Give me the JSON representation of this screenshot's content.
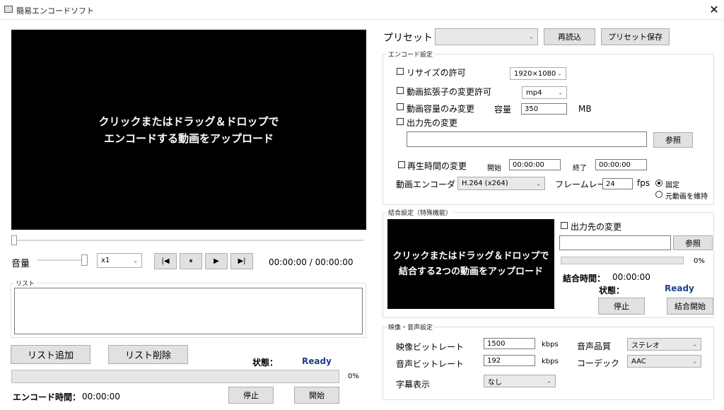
{
  "window": {
    "title": "簡易エンコードソフト",
    "close_glyph": "✕",
    "app_icon": "app-window-icon"
  },
  "preview": {
    "line1": "クリックまたはドラッグ＆ドロップで",
    "line2": "エンコードする動画をアップロード"
  },
  "volume": {
    "label": "音量",
    "level": 1.0
  },
  "seek": {
    "position": 0.0
  },
  "speed": {
    "value": "x1"
  },
  "player": {
    "prev_icon": "skip-previous-icon",
    "prev_glyph": "|◀",
    "pause_icon": "pause-icon",
    "pause_glyph": "⏸",
    "play_icon": "play-icon",
    "play_glyph": "▶",
    "next_icon": "skip-next-icon",
    "next_glyph": "▶|",
    "time": "00:00:00 / 00:00:00"
  },
  "list": {
    "legend": "リスト",
    "add_label": "リスト追加",
    "remove_label": "リスト削除",
    "status_label": "状態：",
    "status_value": "Ready",
    "progress_percent": "0%",
    "progress": 0,
    "encode_time_label": "エンコード時間：",
    "encode_time_value": "00:00:00",
    "stop_label": "停止",
    "start_label": "開始"
  },
  "preset": {
    "label": "プリセット",
    "value": "",
    "reload_label": "再読込",
    "save_label": "プリセット保存"
  },
  "encode": {
    "legend": "エンコード設定",
    "resize_label": "リサイズの許可",
    "resize_value": "1920×1080",
    "ext_label": "動画拡張子の変更許可",
    "ext_value": "mp4",
    "size_only_label": "動画容量のみ変更",
    "capacity_label": "容量",
    "capacity_value": "350",
    "capacity_unit": "MB",
    "output_label": "出力先の変更",
    "output_value": "",
    "browse_label": "参照",
    "playtime_label": "再生時間の変更",
    "start_label": "開始",
    "start_value": "00:00:00",
    "end_label": "終了",
    "end_value": "00:00:00",
    "encoder_label": "動画エンコーダ",
    "encoder_value": "H.264 (x264)",
    "framerate_label": "フレームレート",
    "framerate_value": "24",
    "fps_label": "fps",
    "fixed_label": "固定",
    "keep_label": "元動画を維持"
  },
  "concat": {
    "legend": "結合設定（特殊機能）",
    "drop_line1": "クリックまたはドラッグ＆ドロップで",
    "drop_line2": "結合する2つの動画をアップロード",
    "output_label": "出力先の変更",
    "output_value": "",
    "browse_label": "参照",
    "progress_percent": "0%",
    "progress": 0,
    "time_label": "結合時間：",
    "time_value": "00:00:00",
    "status_label": "状態：",
    "status_value": "Ready",
    "stop_label": "停止",
    "start_label": "結合開始"
  },
  "av": {
    "legend": "映像・音声設定",
    "video_bitrate_label": "映像ビットレート",
    "video_bitrate_value": "1500",
    "kbps1": "kbps",
    "audio_bitrate_label": "音声ビットレート",
    "audio_bitrate_value": "192",
    "kbps2": "kbps",
    "audio_quality_label": "音声品質",
    "audio_quality_value": "ステレオ",
    "codec_label": "コーデック",
    "codec_value": "AAC",
    "subtitle_label": "字幕表示",
    "subtitle_value": "なし"
  }
}
